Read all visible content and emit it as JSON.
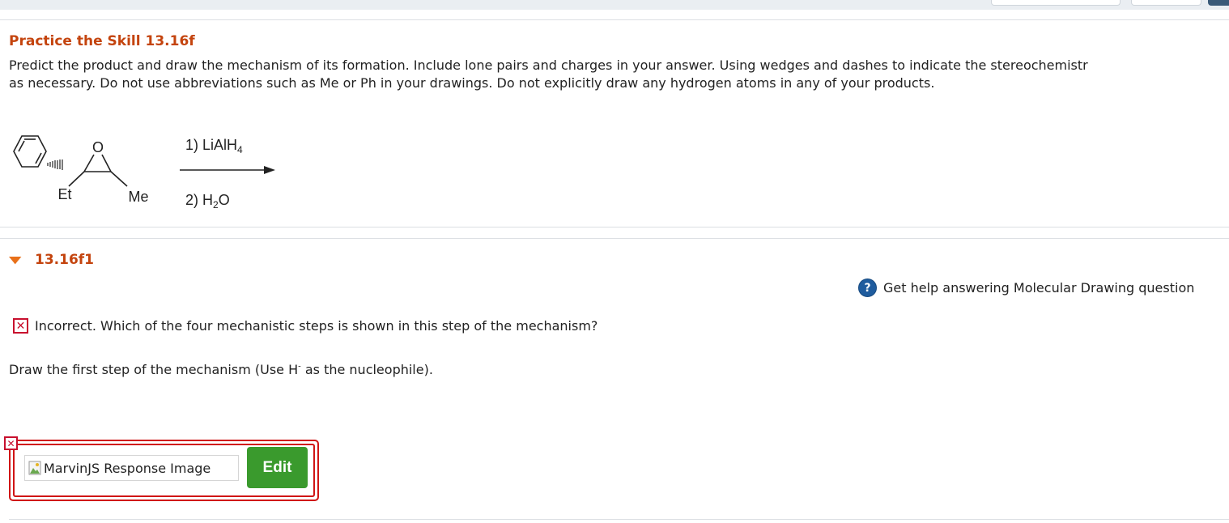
{
  "practice": {
    "title": "Practice the Skill 13.16f",
    "prompt_line1": "Predict the product and draw the mechanism of its formation. Include lone pairs and charges in your answer. Using wedges and dashes to indicate the stereochemistr",
    "prompt_line2": "as necessary. Do not use abbreviations such as Me or Ph in your drawings. Do not explicitly draw any hydrogen atoms in any of your products."
  },
  "reaction": {
    "oxygen_label": "O",
    "et_label": "Et",
    "me_label": "Me",
    "step1_prefix": "1) LiAlH",
    "step1_sub": "4",
    "step2_prefix": "2) H",
    "step2_sub": "2",
    "step2_suffix": "O"
  },
  "part": {
    "title": "13.16f1",
    "help_text": "Get help answering Molecular Drawing question",
    "feedback_text": "Incorrect. Which of the four mechanistic steps is shown in this step of the mechanism?",
    "instruction_prefix": "Draw the first step of the mechanism (Use H",
    "instruction_sup": "-",
    "instruction_suffix": " as the nucleophile).",
    "response_image_alt": "MarvinJS Response Image",
    "edit_label": "Edit"
  },
  "colors": {
    "title_orange": "#c4440e",
    "error_red": "#c8102e",
    "edit_green": "#3a9a2d",
    "help_blue": "#1f5c9e"
  }
}
